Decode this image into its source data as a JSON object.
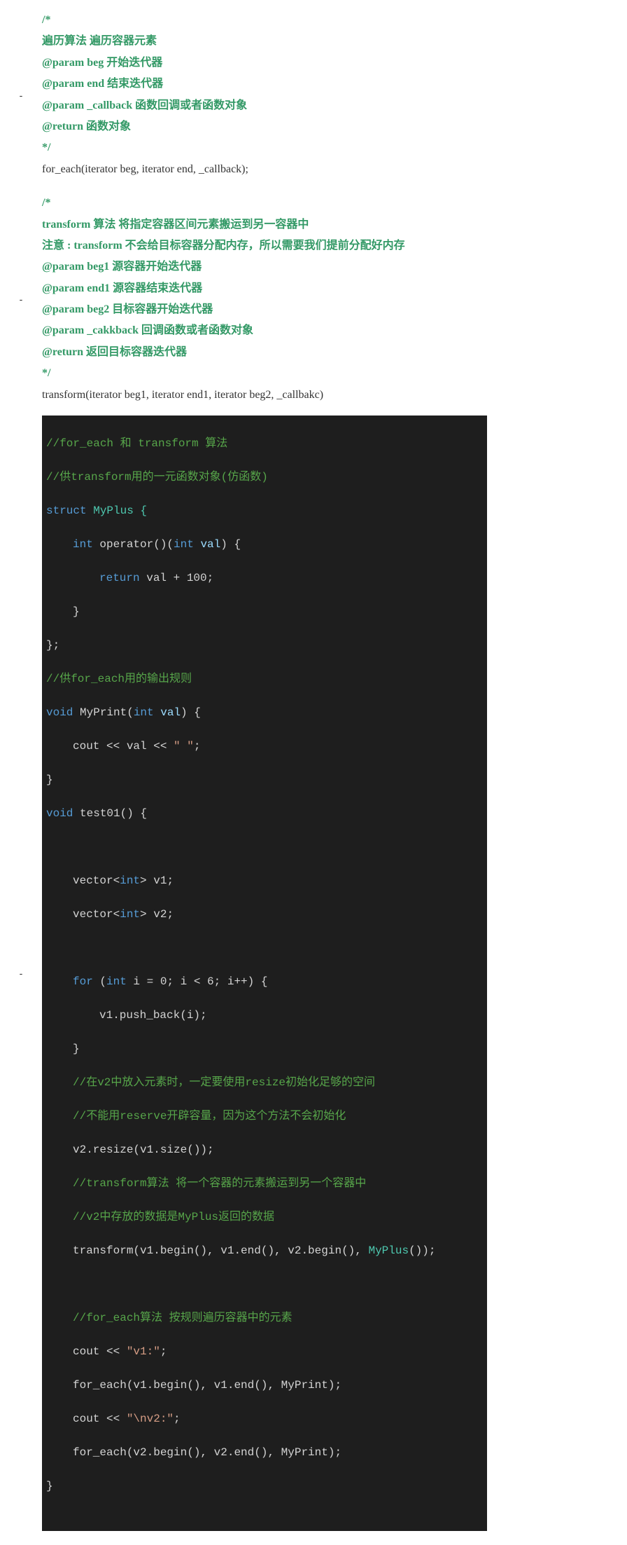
{
  "block1": {
    "comment_open": "/*",
    "line1": "    遍历算法 遍历容器元素",
    "line2": "    @param beg 开始迭代器",
    "line3": "    @param end 结束迭代器",
    "line4": "    @param _callback  函数回调或者函数对象",
    "line5": "    @return 函数对象",
    "comment_close": "*/",
    "signature": "for_each(iterator beg, iterator end, _callback);"
  },
  "block2": {
    "comment_open": "/*",
    "line1": "    transform 算法 将指定容器区间元素搬运到另一容器中",
    "line2": "    注意 : transform 不会给目标容器分配内存，所以需要我们提前分配好内存",
    "line3": "    @param beg1 源容器开始迭代器",
    "line4": "    @param end1 源容器结束迭代器",
    "line5": "    @param beg2 目标容器开始迭代器",
    "line6": "    @param _cakkback 回调函数或者函数对象",
    "line7": "    @return 返回目标容器迭代器",
    "comment_close": "*/",
    "signature": "transform(iterator beg1, iterator end1, iterator beg2, _callbakc)"
  },
  "code": {
    "c1": "//for_each 和 transform 算法",
    "c2": "//供transform用的一元函数对象(仿函数)",
    "c3_struct": "struct",
    "c3_name": " MyPlus {",
    "c4_int": "int",
    "c4_mid": " operator()(",
    "c4_int2": "int",
    "c4_par": " val",
    "c4_end": ") {",
    "c5_ret": "return",
    "c5_rest": " val + 100;",
    "c6": "}",
    "c7": "};",
    "c8": "//供for_each用的输出规则",
    "c9_void": "void",
    "c9_mid": " MyPrint(",
    "c9_int": "int",
    "c9_par": " val",
    "c9_end": ") {",
    "c10a": "cout << val << ",
    "c10b": "\" \"",
    "c10c": ";",
    "c11": "}",
    "c12_void": "void",
    "c12_mid": " test01() {",
    "blank": "",
    "c14a": "vector<",
    "c14b": "int",
    "c14c": "> v1;",
    "c15a": "vector<",
    "c15b": "int",
    "c15c": "> v2;",
    "c17_for": "for",
    "c17_a": " (",
    "c17_int": "int",
    "c17_b": " i = 0; i < 6; i++) {",
    "c18": "v1.push_back(i);",
    "c19": "}",
    "c20": "//在v2中放入元素时，一定要使用resize初始化足够的空间",
    "c21": "//不能用reserve开辟容量，因为这个方法不会初始化",
    "c22": "v2.resize(v1.size());",
    "c23": "//transform算法 将一个容器的元素搬运到另一个容器中",
    "c24": "//v2中存放的数据是MyPlus返回的数据",
    "c25a": "transform(v1.begin(), v1.end(), v2.begin(), ",
    "c25b": "MyPlus",
    "c25c": "());",
    "c27": "//for_each算法 按规则遍历容器中的元素",
    "c28a": "cout << ",
    "c28b": "\"v1:\"",
    "c28c": ";",
    "c29": "for_each(v1.begin(), v1.end(), MyPrint);",
    "c30a": "cout << ",
    "c30b": "\"\\nv2:\"",
    "c30c": ";",
    "c31": "for_each(v2.begin(), v2.end(), MyPrint);",
    "c32": "}"
  },
  "dash": "-"
}
